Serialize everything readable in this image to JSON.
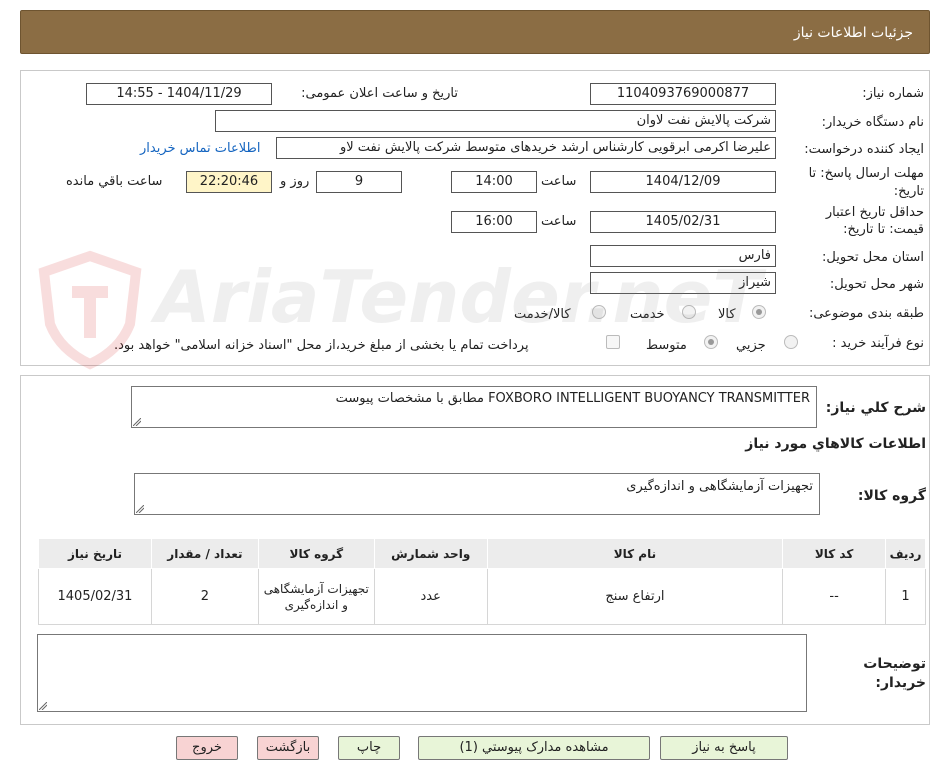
{
  "header": {
    "title": "جزئیات اطلاعات نیاز"
  },
  "form": {
    "need_number_label": "شماره نیاز:",
    "need_number": "1104093769000877",
    "announce_label": "تاریخ و ساعت اعلان عمومی:",
    "announce_value": "1404/11/29 - 14:55",
    "buyer_label": "نام دستگاه خریدار:",
    "buyer_value": "شرکت پالایش نفت لاوان",
    "creator_label": "ایجاد کننده درخواست:",
    "creator_value": "علیرضا اکرمی ابرقویی کارشناس ارشد خریدهای متوسط شرکت پالایش نفت لاو",
    "contact_link": "اطلاعات تماس خریدار",
    "deadline_label_1": "مهلت ارسال پاسخ: تا",
    "deadline_label_2": "تاریخ:",
    "deadline_date": "1404/12/09",
    "time_label": "ساعت",
    "deadline_time": "14:00",
    "days_value": "9",
    "days_label": "روز و",
    "remaining_time": "22:20:46",
    "remaining_label": "ساعت باقي مانده",
    "validity_label_1": "حداقل تاریخ اعتبار",
    "validity_label_2": "قیمت: تا تاریخ:",
    "validity_date": "1405/02/31",
    "validity_time": "16:00",
    "province_label": "استان محل تحویل:",
    "province_value": "فارس",
    "city_label": "شهر محل تحویل:",
    "city_value": "شیراز",
    "category_label": "طبقه بندی موضوعی:",
    "category_options": [
      "کالا",
      "خدمت",
      "کالا/خدمت"
    ],
    "process_label": "نوع فرآیند خرید :",
    "process_options": [
      "جزیي",
      "متوسط"
    ],
    "payment_note": "پرداخت تمام یا بخشی از مبلغ خرید،از محل \"اسناد خزانه اسلامی\" خواهد بود."
  },
  "description": {
    "label": "شرح کلي نیاز:",
    "value": "FOXBORO INTELLIGENT BUOYANCY TRANSMITTER مطابق با مشخصات پیوست"
  },
  "goods": {
    "section_title": "اطلاعات کالاهاي مورد نیاز",
    "group_label": "گروه کالا:",
    "group_value": "تجهیزات آزمایشگاهی و اندازه‌گیری",
    "table": {
      "headers": [
        "ردیف",
        "کد کالا",
        "نام کالا",
        "واحد شمارش",
        "گروه کالا",
        "تعداد / مقدار",
        "تاریخ نیاز"
      ],
      "rows": [
        [
          "1",
          "--",
          "ارتفاع سنج",
          "عدد",
          "تجهیزات آزمایشگاهی و اندازه‌گیری",
          "2",
          "1405/02/31"
        ]
      ]
    }
  },
  "buyer_notes": {
    "label_1": "توضیحات",
    "label_2": "خریدار:",
    "value": ""
  },
  "buttons": {
    "reply": "پاسخ به نیاز",
    "attachments": "مشاهده مدارک پیوستي (1)",
    "print": "چاپ",
    "back": "بازگشت",
    "exit": "خروج"
  },
  "watermark": {
    "text": "AriaTender.neT"
  },
  "colors": {
    "header_bg": "#8b6d44",
    "link": "#1565c0",
    "button_green": "#e8f5d8",
    "button_red": "#f8d3d3",
    "highlight": "#fff5c8"
  }
}
